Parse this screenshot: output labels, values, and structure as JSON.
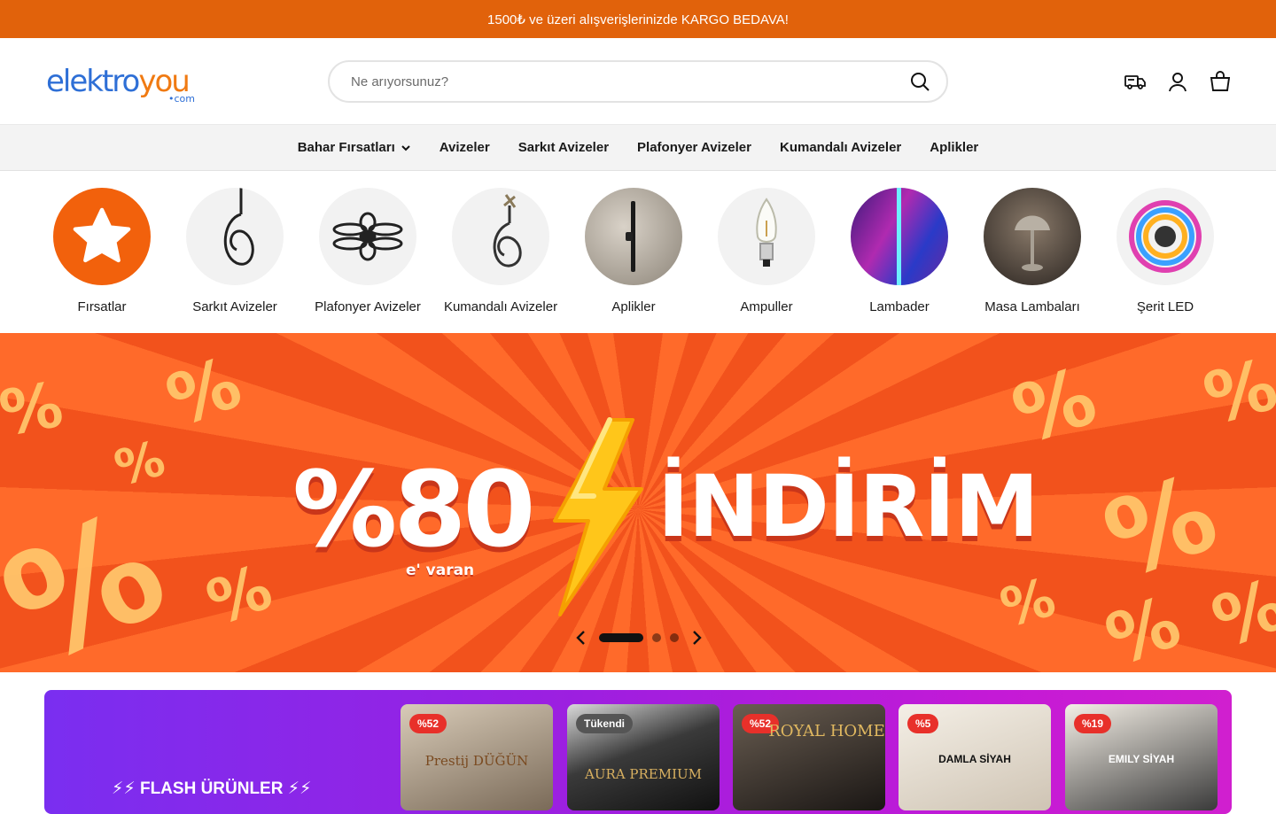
{
  "announcement": "1500₺ ve üzeri alışverişlerinizde KARGO BEDAVA!",
  "logo": {
    "part1": "elektro",
    "part2": "you",
    "suffix": "•com"
  },
  "search": {
    "placeholder": "Ne arıyorsunuz?"
  },
  "header_icons": [
    "truck-icon",
    "user-icon",
    "bag-icon"
  ],
  "nav": {
    "items": [
      "Bahar Fırsatları",
      "Avizeler",
      "Sarkıt Avizeler",
      "Plafonyer Avizeler",
      "Kumandalı Avizeler",
      "Aplikler"
    ]
  },
  "categories": [
    {
      "label": "Fırsatlar",
      "icon": "star-icon"
    },
    {
      "label": "Sarkıt Avizeler",
      "icon": "pendant-lamp-icon"
    },
    {
      "label": "Plafonyer Avizeler",
      "icon": "ceiling-lamp-icon"
    },
    {
      "label": "Kumandalı Avizeler",
      "icon": "remote-chandelier-icon"
    },
    {
      "label": "Aplikler",
      "icon": "wall-lamp-icon"
    },
    {
      "label": "Ampuller",
      "icon": "bulb-icon"
    },
    {
      "label": "Lambader",
      "icon": "floor-lamp-icon"
    },
    {
      "label": "Masa Lambaları",
      "icon": "table-lamp-icon"
    },
    {
      "label": "Şerit LED",
      "icon": "led-strip-icon"
    }
  ],
  "banner": {
    "discount": "%80",
    "sub": "e' varan",
    "word": "İNDİRİM",
    "slides_total": 3,
    "active_slide": 1
  },
  "flash": {
    "title": "⚡⚡ FLASH ÜRÜNLER ⚡⚡",
    "products": [
      {
        "badge": "%52",
        "text": "Prestij DÜĞÜN"
      },
      {
        "badge": "Tükendi",
        "text": "AURA PREMIUM"
      },
      {
        "badge": "%52",
        "text": "ROYAL HOME"
      },
      {
        "badge": "%5",
        "text": "DAMLA SİYAH"
      },
      {
        "badge": "%19",
        "text": "EMILY SİYAH"
      }
    ]
  },
  "colors": {
    "brand_orange": "#e1620b",
    "logo_blue": "#2e6fd6",
    "flash_purple": "#7a2ef0"
  }
}
